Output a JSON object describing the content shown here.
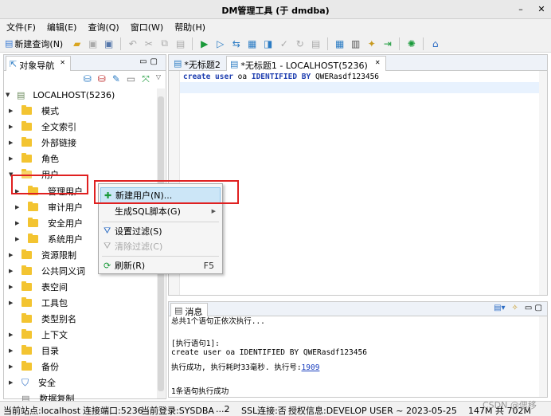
{
  "window": {
    "title": "DM管理工具 (于 dmdba)",
    "controls": [
      "–",
      "✕"
    ]
  },
  "menu": [
    "文件(F)",
    "编辑(E)",
    "查询(Q)",
    "窗口(W)",
    "帮助(H)"
  ],
  "toolbar": {
    "new_query": "新建查询(N)"
  },
  "nav": {
    "tab": "对象导航",
    "tab_close": "✕",
    "root": "LOCALHOST(5236)",
    "items": [
      "模式",
      "全文索引",
      "外部链接",
      "角色",
      "用户"
    ],
    "user_children": [
      "管理用户",
      "审计用户",
      "安全用户",
      "系统用户"
    ],
    "items_after": [
      "资源限制",
      "公共同义词",
      "表空间",
      "工具包",
      "类型别名",
      "上下文",
      "目录",
      "备份",
      "安全",
      "数据复制"
    ]
  },
  "editor": {
    "tabs": [
      "*无标题2",
      "*无标题1 - LOCALHOST(5236)"
    ],
    "tab_close": "✕",
    "code": {
      "kw1": "create user",
      "ident": "oa",
      "kw2": "IDENTIFIED BY",
      "pwd": "QWERasdf123456"
    }
  },
  "messages": {
    "tab": "消息",
    "lines": {
      "partial_top": "总共1个语句正依次执行...",
      "exec_header": "[执行语句1]:",
      "statement": "create user oa IDENTIFIED BY QWERasdf123456",
      "result_prefix": "执行成功, 执行耗时33毫秒. 执行号:",
      "exec_no": "1909",
      "partial_bottom": "1条语句执行成功"
    }
  },
  "context_menu": {
    "new_user": "新建用户(N)...",
    "gen_sql": "生成SQL脚本(G)",
    "set_filter": "设置过滤(S)",
    "clear_filter": "清除过滤(C)",
    "refresh": "刷新(R)",
    "refresh_key": "F5"
  },
  "status": {
    "site": "当前站点:localhost",
    "port": "连接端口:5236",
    "login": "当前登录:SYSDBA",
    "ellipsis": "...2",
    "ssl": "SSL连接:否",
    "license": "授权信息:DEVELOP USER ~ 2023-05-25",
    "memory": "147M 共 702M",
    "watermark": "CSDN @偲移"
  },
  "colors": {
    "highlight": "#cce6f7",
    "annotation": "#e02020",
    "folder": "#f3c431",
    "keyword": "#1f3fb0"
  }
}
